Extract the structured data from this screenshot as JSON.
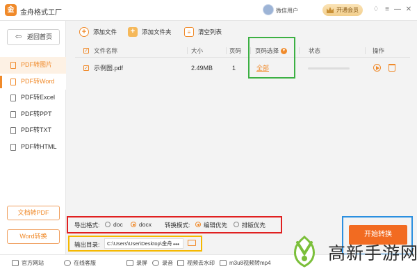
{
  "app": {
    "logo_char": "金",
    "title": "金舟格式工厂"
  },
  "header": {
    "user_name": "微信用户",
    "vip_label": "开通会员"
  },
  "window_controls": {
    "skin": "♢",
    "menu": "≡",
    "minimize": "—",
    "close": "✕"
  },
  "sidebar": {
    "home_label": "返回首页",
    "items": [
      {
        "label": "PDF转图片"
      },
      {
        "label": "PDF转Word"
      },
      {
        "label": "PDF转Excel"
      },
      {
        "label": "PDF转PPT"
      },
      {
        "label": "PDF转TXT"
      },
      {
        "label": "PDF转HTML"
      }
    ],
    "bottom_buttons": [
      "文档转PDF",
      "Word转换"
    ]
  },
  "toolbar": {
    "add_file": "添加文件",
    "add_folder": "添加文件夹",
    "clear_list": "清空列表"
  },
  "table": {
    "headers": {
      "name": "文件名称",
      "size": "大小",
      "pages": "页码",
      "page_select": "页码选择",
      "status": "状态",
      "action": "操作"
    },
    "rows": [
      {
        "name": "示例图.pdf",
        "size": "2.49MB",
        "pages": "1",
        "page_select": "全部",
        "progress": 0
      }
    ]
  },
  "settings": {
    "format_label": "导出格式:",
    "format_options": [
      "doc",
      "docx"
    ],
    "format_selected": "docx",
    "mode_label": "转换模式:",
    "mode_options": [
      "编辑优先",
      "排版优先"
    ],
    "mode_selected": "编辑优先",
    "output_label": "输出目录:",
    "output_path": "C:\\Users\\User\\Desktop\\金舟",
    "more": "•••"
  },
  "start_button": "开始转换",
  "statusbar": {
    "items": [
      "官方网站",
      "在线客服",
      "录屏",
      "录音",
      "视频去水印",
      "m3u8视频转mp4"
    ]
  },
  "watermark": {
    "text": "高新手游网"
  },
  "colors": {
    "accent": "#f08a2a",
    "start": "#f26b21",
    "green_box": "#3cb043",
    "red_box": "#e02020",
    "yellow_box": "#f5b800",
    "blue_box": "#2b8fe0"
  }
}
